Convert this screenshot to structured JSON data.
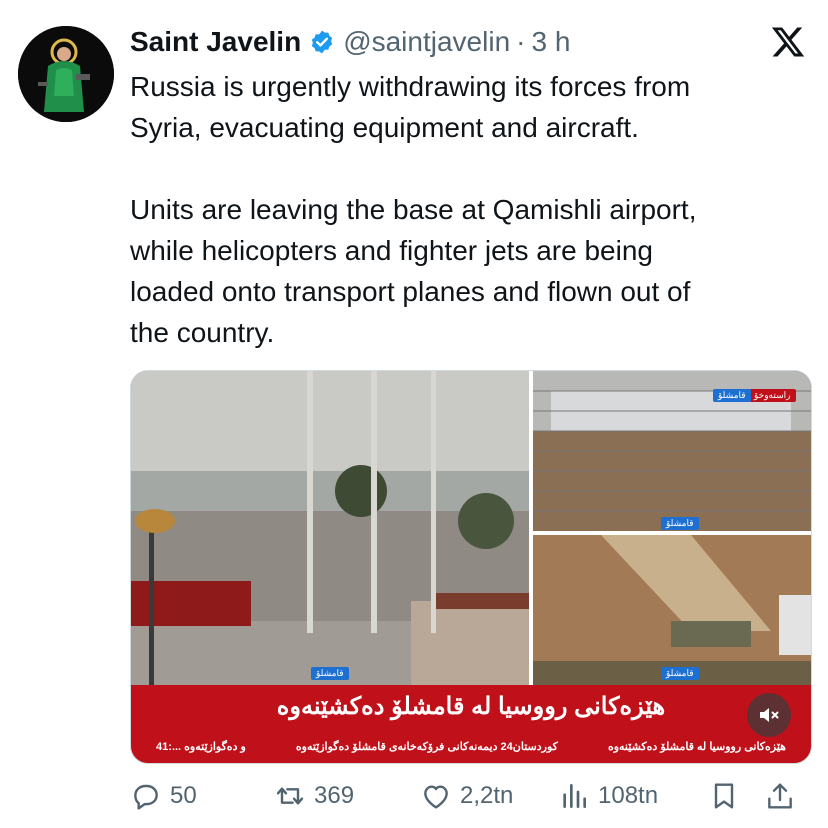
{
  "author": {
    "name": "Saint Javelin",
    "handle": "@saintjavelin",
    "separator": "·",
    "time": "3 h"
  },
  "tweet": {
    "paragraphs": [
      "Russia is urgently withdrawing its forces from\nSyria, evacuating equipment and aircraft.",
      "Units are leaving the base at Qamishli airport,\nwhile helicopters and fighter jets are being\nloaded onto transport planes and flown out of\nthe country."
    ]
  },
  "media": {
    "headline": "هێزەکانی رووسیا لە قامشلۆ دەکشێنەوە",
    "tags": {
      "left": "قامشلۆ",
      "top_right_red": "راستەوخۆ",
      "top_right_blue": "قامشلۆ",
      "mid_right": "قامشلۆ",
      "bottom_right": "قامشلۆ"
    },
    "ticker": [
      "هێزەکانی رووسیا لە قامشلۆ دەکشێنەوە",
      "کوردستان24 دیمەنەکانی فرۆکەخانەی قامشلۆ دەگوازێتەوە",
      "و دەگوازێتەوە ...:41"
    ]
  },
  "actions": {
    "replies": "50",
    "reposts": "369",
    "likes": "2,2tn",
    "views": "108tn"
  },
  "colors": {
    "text": "#0f1419",
    "secondary": "#536471",
    "verified": "#1d9bf0",
    "news_red": "#c0101a"
  },
  "icons": [
    "verified-badge-icon",
    "x-logo-icon",
    "reply-icon",
    "repost-icon",
    "like-icon",
    "views-icon",
    "bookmark-icon",
    "share-icon",
    "mute-icon"
  ]
}
